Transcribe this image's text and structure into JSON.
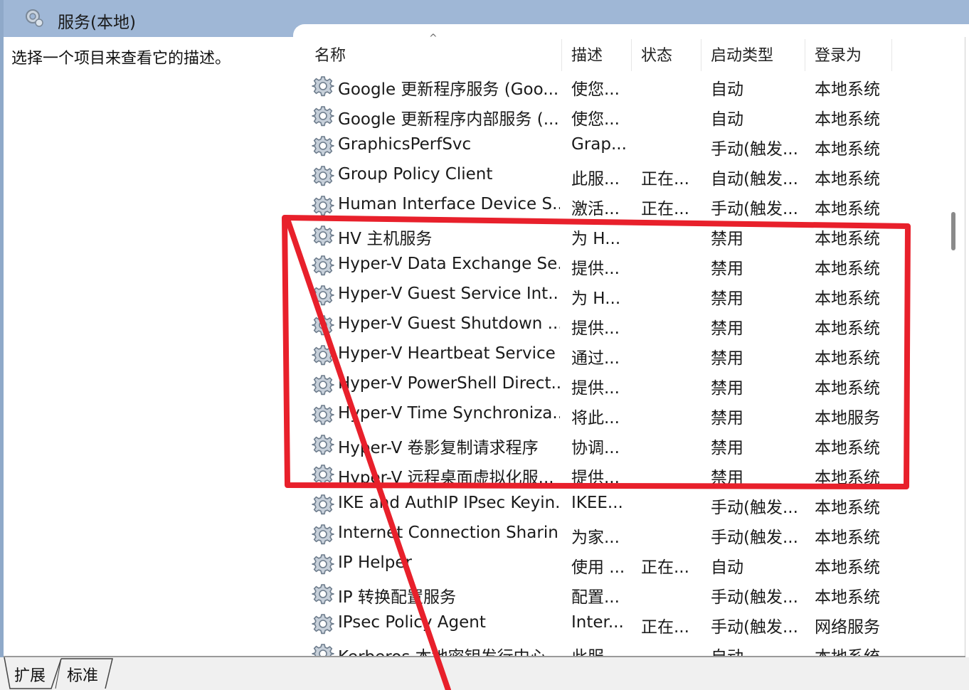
{
  "header": {
    "title": "服务(本地)",
    "icon": "services-gear-icon"
  },
  "description_panel": {
    "text": "选择一个项目来查看它的描述。"
  },
  "columns": {
    "name": "名称",
    "desc": "描述",
    "status": "状态",
    "startup": "启动类型",
    "logon": "登录为"
  },
  "sort_indicator": "^",
  "rows": [
    {
      "name": "Google 更新程序服务 (Goo...",
      "desc": "使您...",
      "status": "",
      "startup": "自动",
      "logon": "本地系统"
    },
    {
      "name": "Google 更新程序内部服务 (...",
      "desc": "使您...",
      "status": "",
      "startup": "自动",
      "logon": "本地系统"
    },
    {
      "name": "GraphicsPerfSvc",
      "desc": "Grap...",
      "status": "",
      "startup": "手动(触发...",
      "logon": "本地系统"
    },
    {
      "name": "Group Policy Client",
      "desc": "此服...",
      "status": "正在...",
      "startup": "自动(触发...",
      "logon": "本地系统"
    },
    {
      "name": "Human Interface Device S...",
      "desc": "激活...",
      "status": "正在...",
      "startup": "手动(触发...",
      "logon": "本地系统"
    },
    {
      "name": "HV 主机服务",
      "desc": "为 H...",
      "status": "",
      "startup": "禁用",
      "logon": "本地系统"
    },
    {
      "name": "Hyper-V Data Exchange Se...",
      "desc": "提供...",
      "status": "",
      "startup": "禁用",
      "logon": "本地系统"
    },
    {
      "name": "Hyper-V Guest Service Int...",
      "desc": "为 H...",
      "status": "",
      "startup": "禁用",
      "logon": "本地系统"
    },
    {
      "name": "Hyper-V Guest Shutdown ...",
      "desc": "提供...",
      "status": "",
      "startup": "禁用",
      "logon": "本地系统"
    },
    {
      "name": "Hyper-V Heartbeat Service",
      "desc": "通过...",
      "status": "",
      "startup": "禁用",
      "logon": "本地系统"
    },
    {
      "name": "Hyper-V PowerShell Direct...",
      "desc": "提供...",
      "status": "",
      "startup": "禁用",
      "logon": "本地系统"
    },
    {
      "name": "Hyper-V Time Synchroniza...",
      "desc": "将此...",
      "status": "",
      "startup": "禁用",
      "logon": "本地服务"
    },
    {
      "name": "Hyper-V 卷影复制请求程序",
      "desc": "协调...",
      "status": "",
      "startup": "禁用",
      "logon": "本地系统"
    },
    {
      "name": "Hyper-V 远程桌面虚拟化服...",
      "desc": "提供...",
      "status": "",
      "startup": "禁用",
      "logon": "本地系统"
    },
    {
      "name": "IKE and AuthIP IPsec Keyin...",
      "desc": "IKEE...",
      "status": "",
      "startup": "手动(触发...",
      "logon": "本地系统"
    },
    {
      "name": "Internet Connection Sharin...",
      "desc": "为家...",
      "status": "",
      "startup": "手动(触发...",
      "logon": "本地系统"
    },
    {
      "name": "IP Helper",
      "desc": "使用 ...",
      "status": "正在...",
      "startup": "自动",
      "logon": "本地系统"
    },
    {
      "name": "IP 转换配置服务",
      "desc": "配置...",
      "status": "",
      "startup": "手动(触发...",
      "logon": "本地系统"
    },
    {
      "name": "IPsec Policy Agent",
      "desc": "Inter...",
      "status": "正在...",
      "startup": "手动(触发...",
      "logon": "网络服务"
    },
    {
      "name": "Kerberos 本地密钥发行中心",
      "desc": "此服...",
      "status": "",
      "startup": "自动",
      "logon": "本地系统"
    }
  ],
  "tabs": [
    {
      "label": "扩展"
    },
    {
      "label": "标准"
    }
  ],
  "annotation": {
    "color": "#e8202b"
  }
}
